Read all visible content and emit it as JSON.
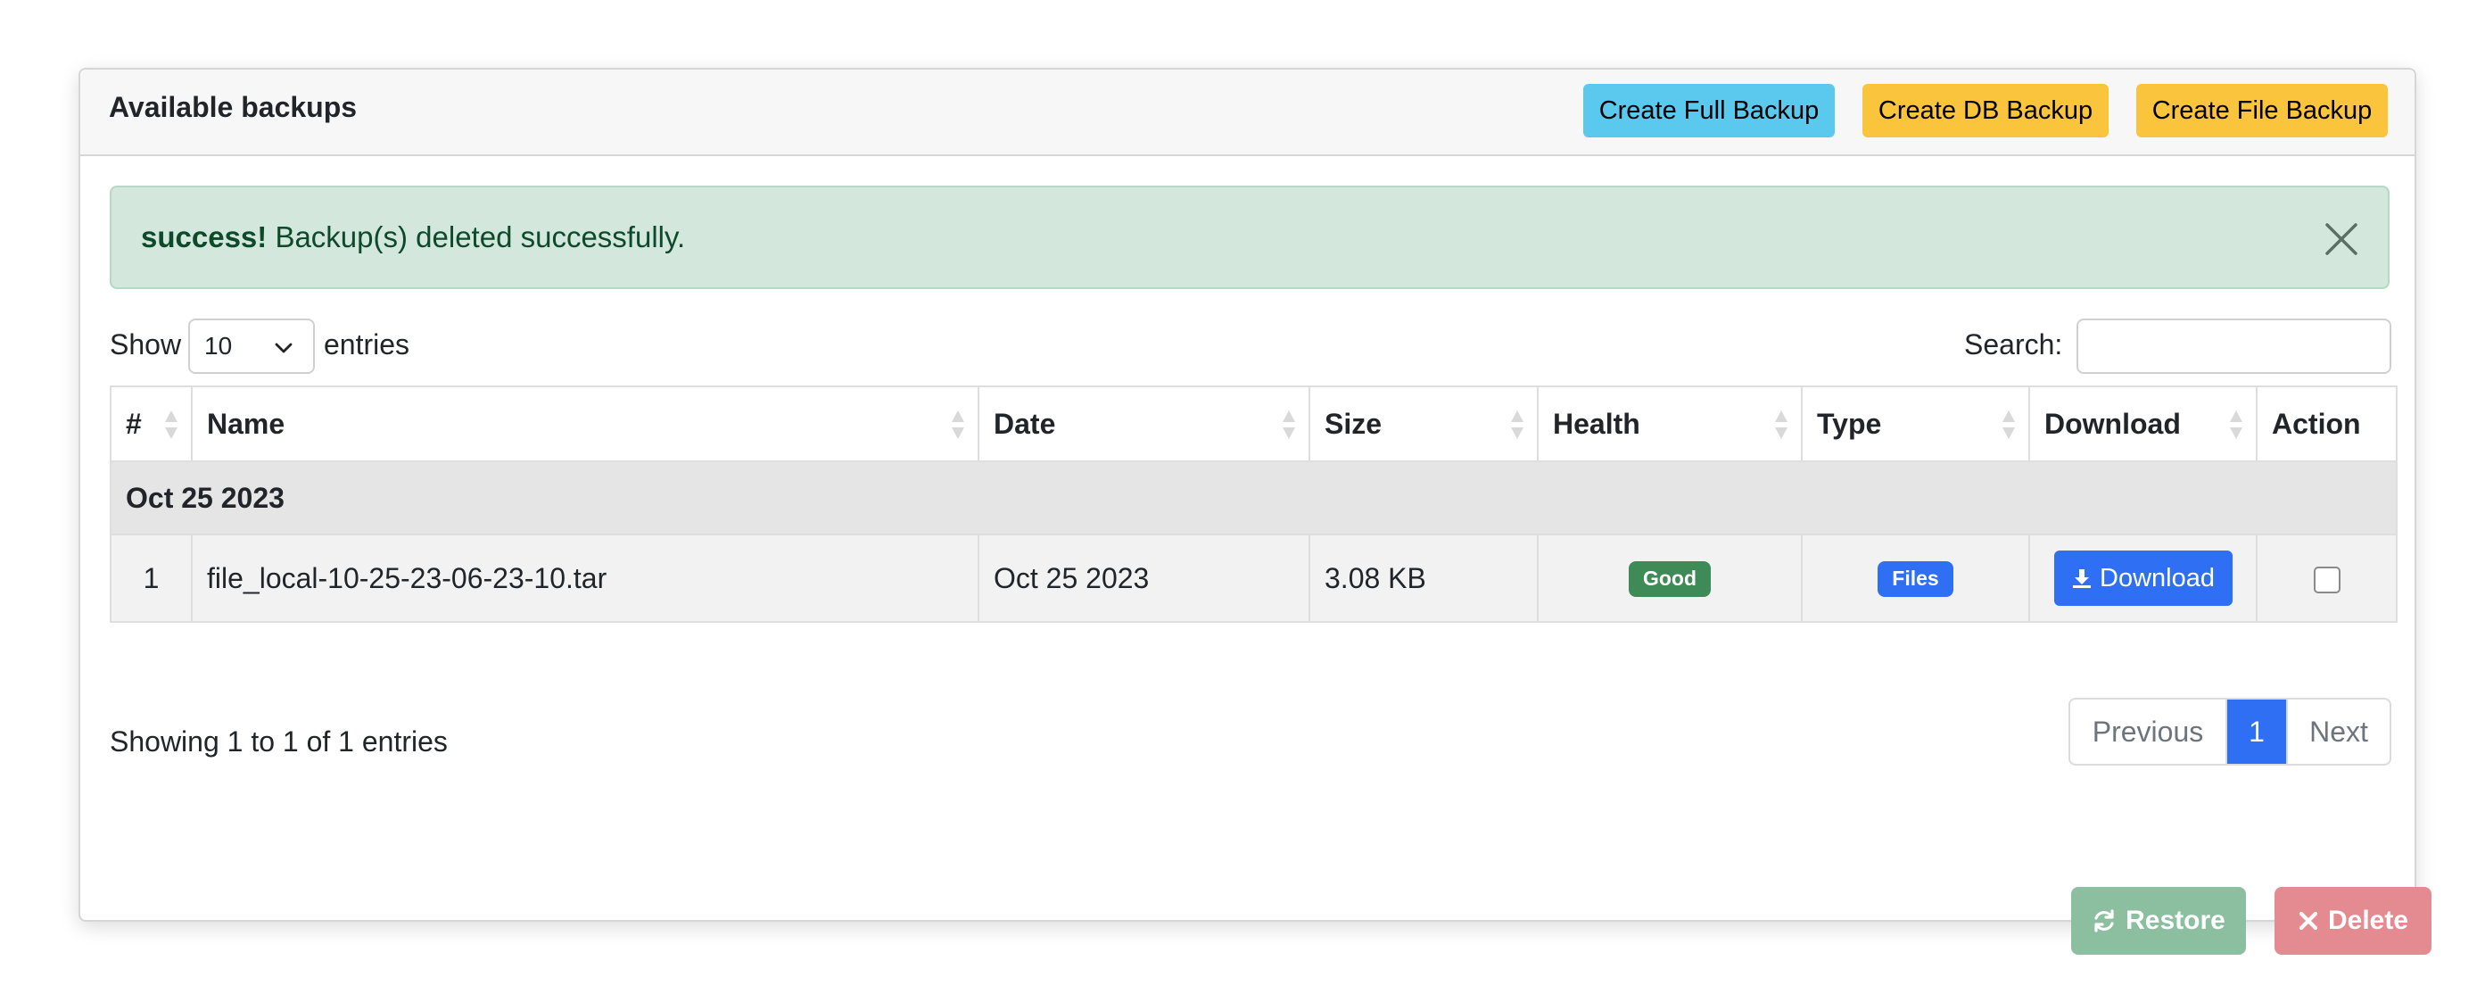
{
  "card": {
    "title": "Available backups",
    "buttons": {
      "full": "Create Full Backup",
      "db": "Create DB Backup",
      "file": "Create File Backup"
    },
    "colors": {
      "info": "#5bc8ee",
      "warning": "#fac43d",
      "primary": "#2f6ff3",
      "success": "#3f8b57",
      "danger": "#e38b91"
    }
  },
  "alert": {
    "strong": "success!",
    "message": "Backup(s) deleted successfully.",
    "close_icon": "close-icon"
  },
  "controls": {
    "show_label": "Show",
    "page_length": "10",
    "entries_label": "entries",
    "search_label": "Search:",
    "search_value": ""
  },
  "table": {
    "columns": [
      "#",
      "Name",
      "Date",
      "Size",
      "Health",
      "Type",
      "Download",
      "Action"
    ],
    "group": "Oct 25 2023",
    "rows": [
      {
        "num": "1",
        "name": "file_local-10-25-23-06-23-10.tar",
        "date": "Oct 25 2023",
        "size": "3.08 KB",
        "health": "Good",
        "type": "Files",
        "download": "Download",
        "selected": false
      }
    ]
  },
  "footer": {
    "info": "Showing 1 to 1 of 1 entries",
    "pagination": {
      "previous": "Previous",
      "current": "1",
      "next": "Next"
    },
    "restore": "Restore",
    "delete": "Delete"
  }
}
